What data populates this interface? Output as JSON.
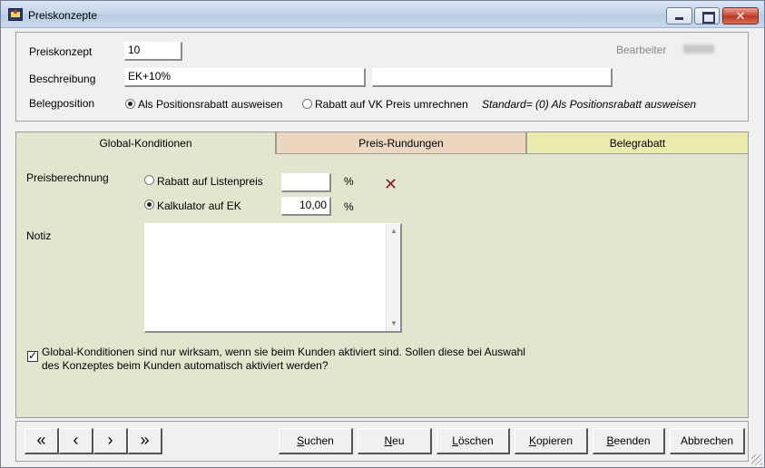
{
  "window": {
    "title": "Preiskonzepte"
  },
  "header": {
    "preiskonzept_label": "Preiskonzept",
    "preiskonzept_value": "10",
    "beschreibung_label": "Beschreibung",
    "beschreibung_value": "EK+10%",
    "beschreibung_value2": "",
    "bearbeiter_label": "Bearbeiter",
    "belegposition_label": "Belegposition",
    "option_positionsrabatt": "Als Positionsrabatt ausweisen",
    "option_vk_preis": "Rabatt auf VK Preis umrechnen",
    "standard_hint": "Standard= (0) Als Positionsrabatt ausweisen",
    "selected_option": "positionsrabatt"
  },
  "tabs": [
    {
      "label": "Global-Konditionen",
      "active": true,
      "color": "#e2e6cf"
    },
    {
      "label": "Preis-Rundungen",
      "active": false,
      "color": "#ecd6c0"
    },
    {
      "label": "Belegrabatt",
      "active": false,
      "color": "#ecebae"
    }
  ],
  "global": {
    "preisberechnung_label": "Preisberechnung",
    "rabatt_listenpreis_label": "Rabatt auf Listenpreis",
    "rabatt_listenpreis_value": "",
    "kalkulator_ek_label": "Kalkulator auf EK",
    "kalkulator_ek_value": "10,00",
    "percent_symbol": "%",
    "selected": "kalkulator",
    "notiz_label": "Notiz",
    "notiz_value": "",
    "checkbox_checked": true,
    "checkbox_text_line1": "Global-Konditionen sind nur wirksam, wenn sie beim Kunden aktiviert sind. Sollen diese bei Auswahl",
    "checkbox_text_line2": "des Konzeptes beim Kunden automatisch aktiviert werden?"
  },
  "buttons": {
    "first": "«",
    "prev": "‹",
    "next": "›",
    "last": "»",
    "suchen_ul": "S",
    "suchen_rest": "uchen",
    "neu_ul": "N",
    "neu_rest": "eu",
    "loeschen_ul": "L",
    "loeschen_rest": "öschen",
    "kopieren_ul": "K",
    "kopieren_rest": "opieren",
    "beenden_ul": "B",
    "beenden_rest": "eenden",
    "abbrechen": "Abbrechen"
  }
}
